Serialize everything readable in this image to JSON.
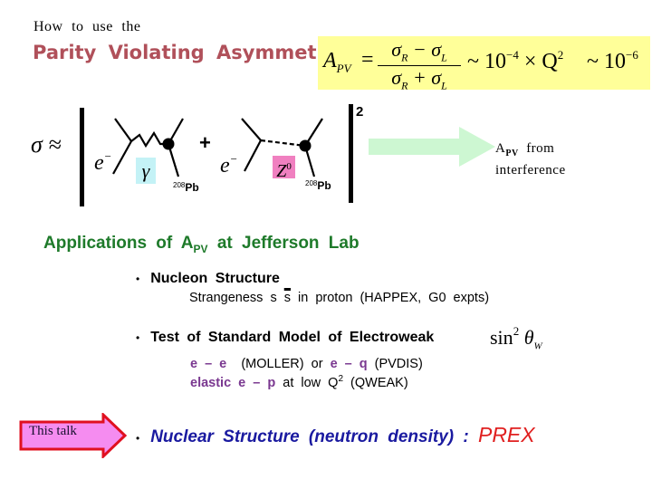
{
  "header": {
    "intro": "How to use the",
    "title": "Parity Violating Asymmetry ?"
  },
  "formula": {
    "lhs": "A",
    "lhs_sub": "PV",
    "equals": "=",
    "numerator": "σ_R − σ_L",
    "denominator": "σ_R + σ_L",
    "approx1": "~ 10",
    "approx1_exp": "−4",
    "times_q": "× Q",
    "q_exp": "2",
    "approx2": "~ 10",
    "approx2_exp": "−6",
    "background_color": "#ffff99"
  },
  "diagram": {
    "sigma_approx": "σ ≈",
    "plus": "+",
    "squared": "2",
    "electron_label": "e",
    "electron_charge": "−",
    "photon_label": "γ",
    "photon_color": "#c4f2f6",
    "z_label": "Z",
    "z_sup": "0",
    "z_color": "#f080c0",
    "target_mass": "208",
    "target": "Pb",
    "arrow_color": "#cdf7d2",
    "result_line1_A": "A",
    "result_line1_sub": "PV",
    "result_line1_rest": "from",
    "result_line2": "interference"
  },
  "applications": {
    "title_pre": "Applications of A",
    "title_sub": "PV",
    "title_post": "at Jefferson Lab",
    "title_color": "#1e7a2a",
    "items": [
      {
        "bullet": "•",
        "label": "Nucleon Structure",
        "detail_pre": "Strangeness s",
        "detail_bar": "s",
        "detail_post": "in proton (HAPPEX, G0 expts)"
      },
      {
        "bullet": "•",
        "label": "Test of Standard Model of Electroweak",
        "math": "sin",
        "math_exp": "2",
        "math_theta": "θ",
        "math_sub": "W",
        "line1_a": "e – e",
        "line1_b": "(MOLLER) or",
        "line1_c": "e – q",
        "line1_d": "(PVDIS)",
        "line2_a": "elastic e – p",
        "line2_b": "at low Q",
        "line2_exp": "2",
        "line2_c": "(QWEAK)"
      },
      {
        "bullet": "•",
        "label": "Nuclear Structure (neutron density) :",
        "highlight": "PREX",
        "highlight_color": "#e02020"
      }
    ]
  },
  "callout": {
    "label": "This talk",
    "fill_color": "#f58cf0",
    "border_color": "#e01020"
  }
}
